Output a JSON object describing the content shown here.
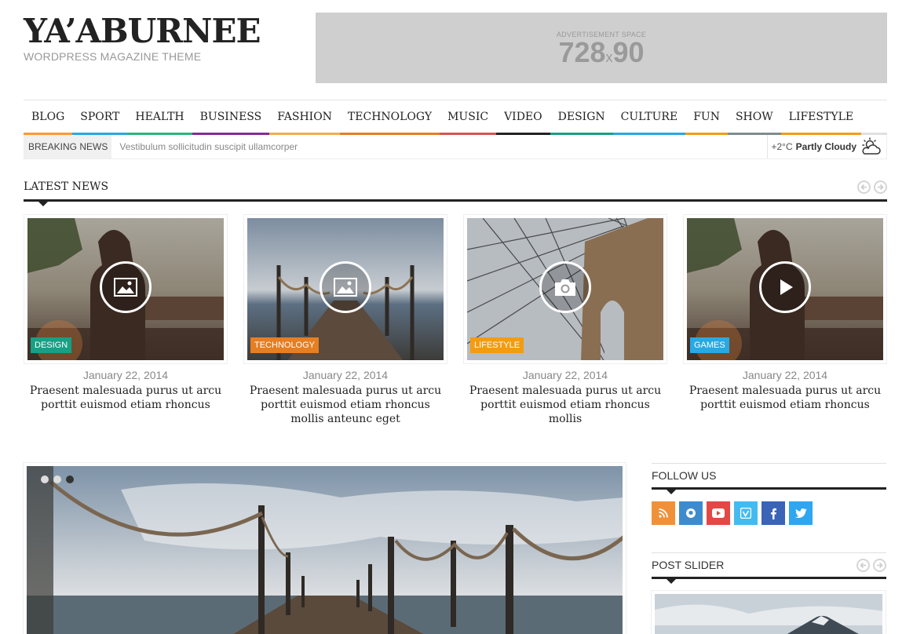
{
  "brand": {
    "title": "YA’ABURNEE",
    "subtitle": "WORDPRESS MAGAZINE THEME"
  },
  "ad": {
    "label": "ADVERTISEMENT SPACE",
    "width": "728",
    "x": "x",
    "height": "90"
  },
  "nav": {
    "items": [
      {
        "label": "BLOG",
        "color": "#ff9933"
      },
      {
        "label": "SPORT",
        "color": "#27a9e3"
      },
      {
        "label": "HEALTH",
        "color": "#28b779"
      },
      {
        "label": "BUSINESS",
        "color": "#852b99"
      },
      {
        "label": "FASHION",
        "color": "#f0ad4e"
      },
      {
        "label": "TECHNOLOGY",
        "color": "#e67e22"
      },
      {
        "label": "MUSIC",
        "color": "#d9534f"
      },
      {
        "label": "VIDEO",
        "color": "#222222"
      },
      {
        "label": "DESIGN",
        "color": "#16a085"
      },
      {
        "label": "CULTURE",
        "color": "#27a9e3"
      },
      {
        "label": "FUN",
        "color": "#f39c12"
      },
      {
        "label": "SHOW",
        "color": "#7f8c8d"
      },
      {
        "label": "LIFESTYLE",
        "color": "#f39c12"
      }
    ]
  },
  "breaking": {
    "label": "BREAKING NEWS",
    "text": "Vestibulum sollicitudin suscipit ullamcorper"
  },
  "weather": {
    "temp": "+2°C",
    "condition": "Partly Cloudy",
    "icon": "partly-cloudy-icon"
  },
  "latest": {
    "title": "LATEST NEWS",
    "cards": [
      {
        "tag": "DESIGN",
        "tag_color": "#16a085",
        "icon": "image-icon",
        "date": "January 22, 2014",
        "title": "Praesent malesuada purus ut arcu porttit euismod etiam rhoncus"
      },
      {
        "tag": "TECHNOLOGY",
        "tag_color": "#e67e22",
        "icon": "image-icon",
        "date": "January 22, 2014",
        "title": "Praesent malesuada purus ut arcu porttit euismod etiam rhoncus mollis anteunc eget"
      },
      {
        "tag": "LIFESTYLE",
        "tag_color": "#f39c12",
        "icon": "camera-icon",
        "date": "January 22, 2014",
        "title": "Praesent malesuada purus ut arcu porttit euismod etiam rhoncus mollis"
      },
      {
        "tag": "GAMES",
        "tag_color": "#27a9e3",
        "icon": "play-icon",
        "date": "January 22, 2014",
        "title": "Praesent malesuada purus ut arcu porttit euismod etiam rhoncus"
      }
    ]
  },
  "follow": {
    "title": "FOLLOW US",
    "networks": [
      {
        "name": "rss-icon",
        "color": "#f0913a"
      },
      {
        "name": "github-icon",
        "color": "#3d8bcd"
      },
      {
        "name": "youtube-icon",
        "color": "#e34845"
      },
      {
        "name": "vimeo-icon",
        "color": "#44bbf0"
      },
      {
        "name": "facebook-icon",
        "color": "#3b63b6"
      },
      {
        "name": "twitter-icon",
        "color": "#2fa6ef"
      }
    ]
  },
  "post_slider": {
    "title": "POST SLIDER"
  },
  "main_slider": {
    "active_dot": 2
  }
}
